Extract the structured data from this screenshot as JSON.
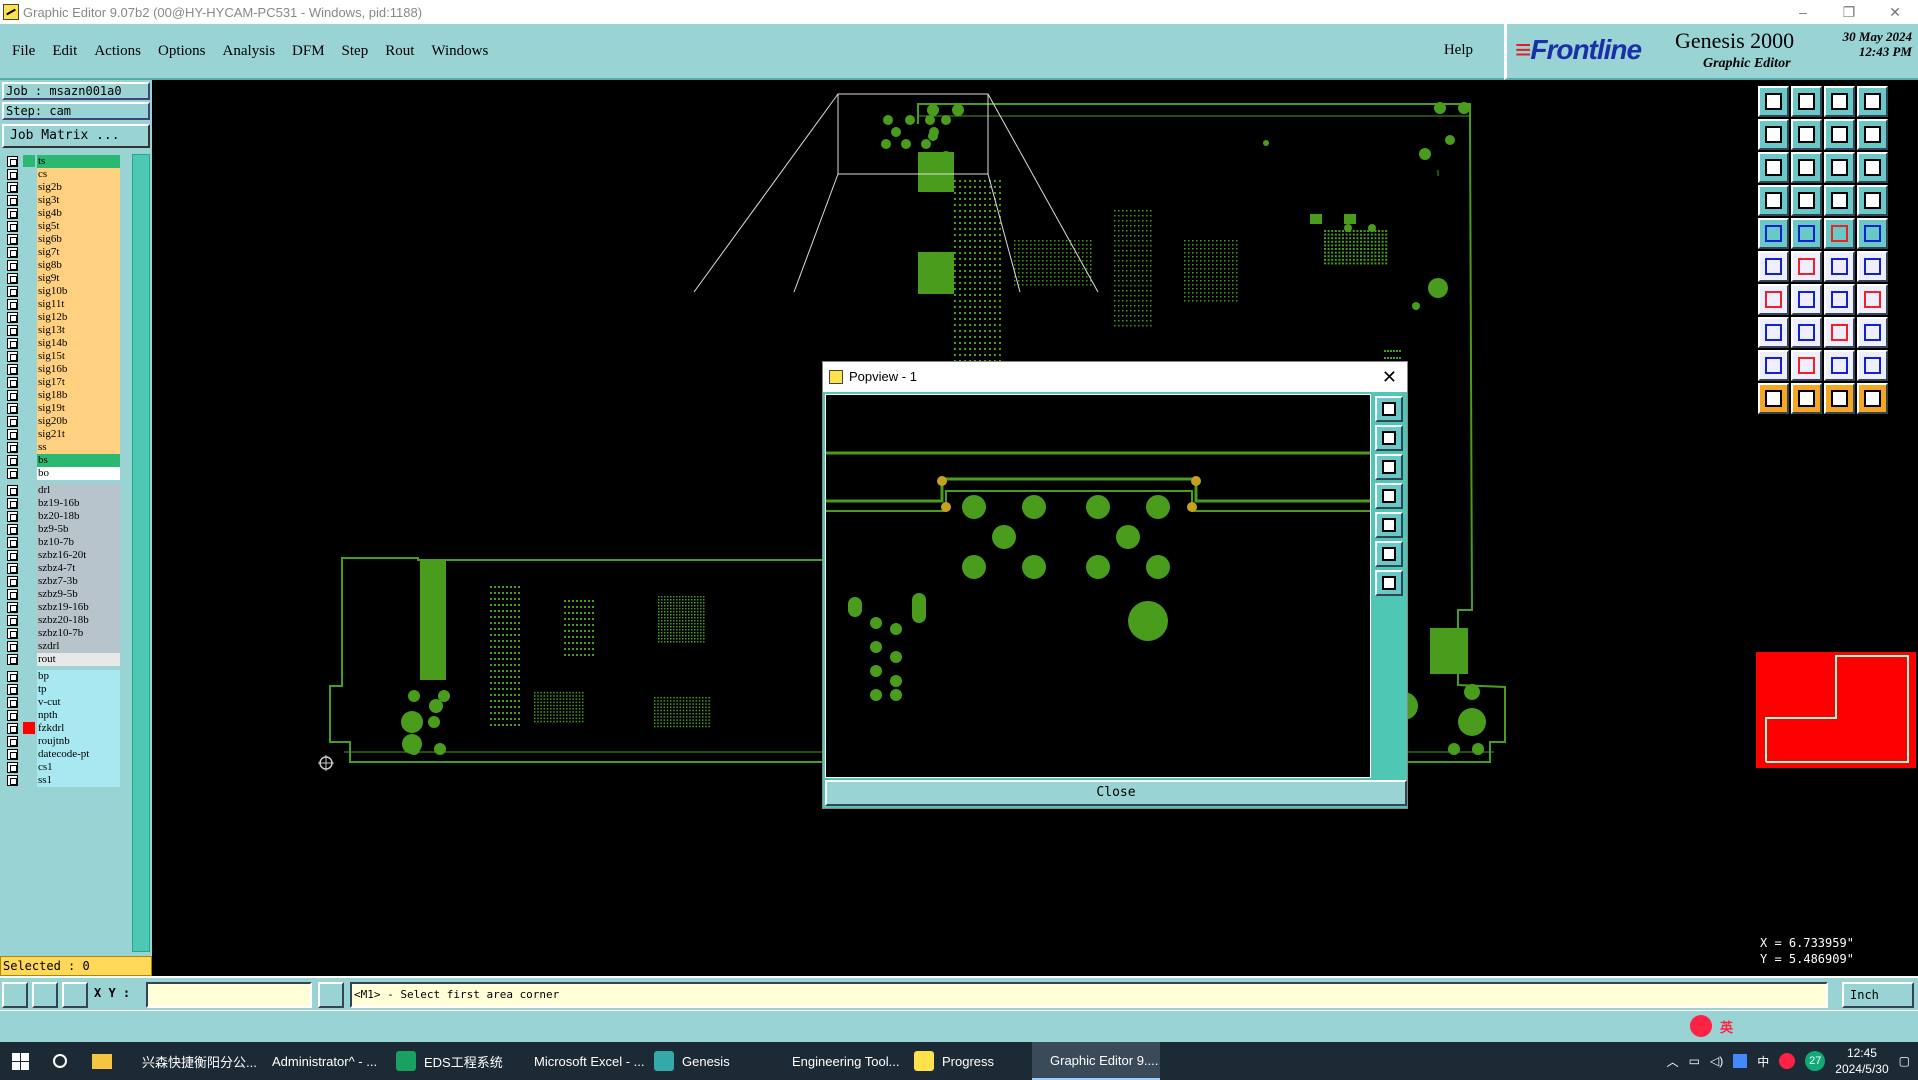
{
  "window": {
    "title": "Graphic Editor 9.07b2 (00@HY-HYCAM-PC531 - Windows, pid:1188)",
    "controls": [
      "–",
      "❐",
      "✕"
    ]
  },
  "menu": {
    "items": [
      "File",
      "Edit",
      "Actions",
      "Options",
      "Analysis",
      "DFM",
      "Step",
      "Rout",
      "Windows"
    ],
    "help": "Help"
  },
  "brand": {
    "logo": "Frontline",
    "product": "Genesis 2000",
    "subtitle": "Graphic Editor",
    "date": "30 May 2024",
    "time": "12:43 PM"
  },
  "job": {
    "job_label": "Job : msazn001a0",
    "step_label": "Step: cam",
    "matrix_button": "Job Matrix ..."
  },
  "layers": [
    {
      "name": "ts",
      "color": "#2bb870",
      "swatch": "#2bb870"
    },
    {
      "name": "cs",
      "color": "#ffd080",
      "swatch": "#99d3d3"
    },
    {
      "name": "sig2b",
      "color": "#ffd080",
      "swatch": "#99d3d3"
    },
    {
      "name": "sig3t",
      "color": "#ffd080",
      "swatch": "#99d3d3"
    },
    {
      "name": "sig4b",
      "color": "#ffd080",
      "swatch": "#99d3d3"
    },
    {
      "name": "sig5t",
      "color": "#ffd080",
      "swatch": "#99d3d3"
    },
    {
      "name": "sig6b",
      "color": "#ffd080",
      "swatch": "#99d3d3"
    },
    {
      "name": "sig7t",
      "color": "#ffd080",
      "swatch": "#99d3d3"
    },
    {
      "name": "sig8b",
      "color": "#ffd080",
      "swatch": "#99d3d3"
    },
    {
      "name": "sig9t",
      "color": "#ffd080",
      "swatch": "#99d3d3"
    },
    {
      "name": "sig10b",
      "color": "#ffd080",
      "swatch": "#99d3d3"
    },
    {
      "name": "sig11t",
      "color": "#ffd080",
      "swatch": "#99d3d3"
    },
    {
      "name": "sig12b",
      "color": "#ffd080",
      "swatch": "#99d3d3"
    },
    {
      "name": "sig13t",
      "color": "#ffd080",
      "swatch": "#99d3d3"
    },
    {
      "name": "sig14b",
      "color": "#ffd080",
      "swatch": "#99d3d3"
    },
    {
      "name": "sig15t",
      "color": "#ffd080",
      "swatch": "#99d3d3"
    },
    {
      "name": "sig16b",
      "color": "#ffd080",
      "swatch": "#99d3d3"
    },
    {
      "name": "sig17t",
      "color": "#ffd080",
      "swatch": "#99d3d3"
    },
    {
      "name": "sig18b",
      "color": "#ffd080",
      "swatch": "#99d3d3"
    },
    {
      "name": "sig19t",
      "color": "#ffd080",
      "swatch": "#99d3d3"
    },
    {
      "name": "sig20b",
      "color": "#ffd080",
      "swatch": "#99d3d3"
    },
    {
      "name": "sig21t",
      "color": "#ffd080",
      "swatch": "#99d3d3"
    },
    {
      "name": "ss",
      "color": "#ffd080",
      "swatch": "#99d3d3"
    },
    {
      "name": "bs",
      "color": "#2bb870",
      "swatch": "#99d3d3"
    },
    {
      "name": "bo",
      "color": "#ffffff",
      "swatch": "#99d3d3"
    },
    {
      "name": "drl",
      "color": "#b8c4cc",
      "swatch": "#99d3d3"
    },
    {
      "name": "bz19-16b",
      "color": "#b8c4cc",
      "swatch": "#99d3d3"
    },
    {
      "name": "bz20-18b",
      "color": "#b8c4cc",
      "swatch": "#99d3d3"
    },
    {
      "name": "bz9-5b",
      "color": "#b8c4cc",
      "swatch": "#99d3d3"
    },
    {
      "name": "bz10-7b",
      "color": "#b8c4cc",
      "swatch": "#99d3d3"
    },
    {
      "name": "szbz16-20t",
      "color": "#b8c4cc",
      "swatch": "#99d3d3"
    },
    {
      "name": "szbz4-7t",
      "color": "#b8c4cc",
      "swatch": "#99d3d3"
    },
    {
      "name": "szbz7-3b",
      "color": "#b8c4cc",
      "swatch": "#99d3d3"
    },
    {
      "name": "szbz9-5b",
      "color": "#b8c4cc",
      "swatch": "#99d3d3"
    },
    {
      "name": "szbz19-16b",
      "color": "#b8c4cc",
      "swatch": "#99d3d3"
    },
    {
      "name": "szbz20-18b",
      "color": "#b8c4cc",
      "swatch": "#99d3d3"
    },
    {
      "name": "szbz10-7b",
      "color": "#b8c4cc",
      "swatch": "#99d3d3"
    },
    {
      "name": "szdrl",
      "color": "#b8c4cc",
      "swatch": "#99d3d3"
    },
    {
      "name": "rout",
      "color": "#e8e8e8",
      "swatch": "#99d3d3"
    },
    {
      "name": "bp",
      "color": "#a8e8f0",
      "swatch": "#99d3d3"
    },
    {
      "name": "tp",
      "color": "#a8e8f0",
      "swatch": "#99d3d3"
    },
    {
      "name": "v-cut",
      "color": "#a8e8f0",
      "swatch": "#99d3d3"
    },
    {
      "name": "npth",
      "color": "#a8e8f0",
      "swatch": "#99d3d3"
    },
    {
      "name": "fzkdrl",
      "color": "#a8e8f0",
      "swatch": "#ff0000"
    },
    {
      "name": "roujtnb",
      "color": "#a8e8f0",
      "swatch": "#99d3d3"
    },
    {
      "name": "datecode-pt",
      "color": "#a8e8f0",
      "swatch": "#99d3d3"
    },
    {
      "name": "cs1",
      "color": "#a8e8f0",
      "swatch": "#99d3d3"
    },
    {
      "name": "ss1",
      "color": "#a8e8f0",
      "swatch": "#99d3d3"
    }
  ],
  "selected": "Selected : 0",
  "toolbar_icons": [
    "zoom-home-icon",
    "zoom-out-icon",
    "home-icon",
    "split-view-icon",
    "pan-left-icon",
    "pan-right-icon",
    "redraw-icon",
    "snap-icon",
    "fit-icon",
    "center-icon",
    "ratio-icon",
    "query-icon",
    "measure-icon",
    "grid-icon",
    "layers-icon",
    "filter-icon",
    "pad-icon",
    "line-icon",
    "ruler-icon",
    "circle-icon",
    "add-node-icon",
    "cross-icon",
    "move-icon",
    "copy-icon",
    "draw-line-icon",
    "slash-icon",
    "arc-icon",
    "route-icon",
    "feature-icon",
    "dash-icon",
    "dimension-icon",
    "shape-icon",
    "triangle-icon",
    "triangle-up-icon",
    "arch-icon",
    "polygon-icon",
    "pointer-icon",
    "select-icon",
    "pick-icon",
    "move-select-icon"
  ],
  "coords": {
    "x": "X =  6.733959\"",
    "y": "Y =  5.486909\""
  },
  "status": {
    "xy_label": "X Y :",
    "xy_value": "",
    "prompt": "<M1> - Select first area corner",
    "units": "Inch"
  },
  "popview": {
    "title": "Popview - 1",
    "close_button": "Close",
    "icons": [
      "zoom-icon",
      "up-icon",
      "down-icon",
      "left-icon",
      "right-icon",
      "fit-icon",
      "center-icon"
    ]
  },
  "taskbar": {
    "items": [
      {
        "label": "兴森快捷衡阳分公...",
        "color": "#f5a623"
      },
      {
        "label": "Administrator^ - ...",
        "color": "#5b5bd6"
      },
      {
        "label": "EDS工程系统",
        "color": "#1aa060"
      },
      {
        "label": "Microsoft Excel - ...",
        "color": "#1d7a45"
      },
      {
        "label": "Genesis",
        "color": "#3aa"
      },
      {
        "label": "Engineering Tool...",
        "color": "#ffe14a"
      },
      {
        "label": "Progress",
        "color": "#ffe14a"
      },
      {
        "label": "Graphic Editor 9....",
        "color": "#ffe14a"
      }
    ],
    "tray": {
      "lang": "中",
      "badge": "27",
      "time": "12:45",
      "date": "2024/5/30"
    },
    "ime": {
      "label": "英"
    }
  }
}
